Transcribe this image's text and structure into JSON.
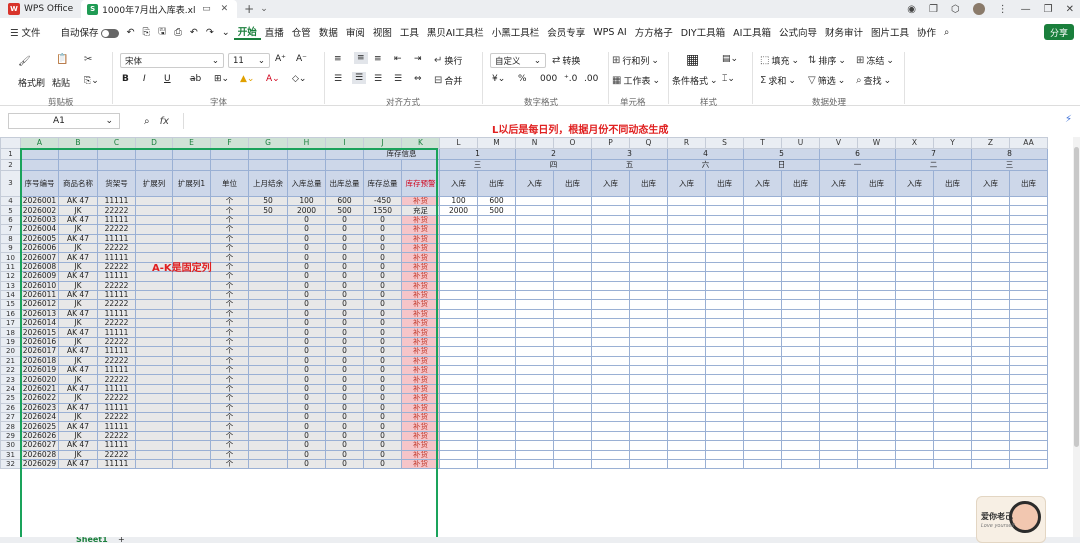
{
  "titlebar": {
    "app_name": "WPS Office",
    "file_tab": "1000年7月出入库表.xlsx",
    "new_tab": "+"
  },
  "menubar": {
    "file_menu": "☰ 文件",
    "autosave": "自动保存",
    "tabs": [
      "开始",
      "直播",
      "仓管",
      "数据",
      "审阅",
      "视图",
      "工具",
      "黑贝AI工具栏",
      "小黑工具栏",
      "会员专享",
      "WPS AI",
      "方方格子",
      "DIY工具箱",
      "AI工具箱",
      "公式向导",
      "财务审计",
      "图片工具",
      "协作"
    ],
    "active_tab": "开始",
    "share": "分享"
  },
  "ribbon": {
    "format_painter": "格式刷",
    "paste": "粘贴",
    "clipboard_label": "剪贴板",
    "font_name": "宋体",
    "font_size": "11",
    "font_label": "字体",
    "bold": "B",
    "italic": "I",
    "underline": "U",
    "wrap": "换行",
    "merge": "合并",
    "align_label": "对齐方式",
    "number_format": "自定义",
    "convert": "转换",
    "number_label": "数字格式",
    "row_col": "行和列",
    "worksheet": "工作表",
    "cell_label": "单元格",
    "cond_format": "条件格式",
    "style_label": "样式",
    "fill": "填充",
    "sort": "排序",
    "freeze": "冻结",
    "sum": "求和",
    "filter": "筛选",
    "find": "查找",
    "data_label": "数据处理"
  },
  "formula_bar": {
    "cell_ref": "A1",
    "fx": "fx",
    "value": ""
  },
  "sheet": {
    "columns": [
      "A",
      "B",
      "C",
      "D",
      "E",
      "F",
      "G",
      "H",
      "I",
      "J",
      "K",
      "L",
      "M",
      "N",
      "O",
      "P",
      "Q",
      "R",
      "S",
      "T",
      "U",
      "V",
      "W",
      "X",
      "Y",
      "Z",
      "AA"
    ],
    "header_row3": [
      "序号编号",
      "商品名称",
      "货架号",
      "扩展列",
      "扩展列1",
      "单位",
      "上月结余",
      "入库总量",
      "出库总量",
      "库存总量",
      "库存预警"
    ],
    "stock_info_label": "库存信息",
    "days": [
      "1",
      "2",
      "3",
      "4",
      "5",
      "6",
      "7",
      "8"
    ],
    "weekdays": [
      "三",
      "四",
      "五",
      "六",
      "日",
      "一",
      "二",
      "三"
    ],
    "in_label": "入库",
    "out_label": "出库",
    "row_numbers": [
      "1",
      "2",
      "3",
      "4",
      "5",
      "6",
      "7",
      "8",
      "9",
      "10",
      "11",
      "12",
      "13",
      "14",
      "15",
      "16",
      "17",
      "18",
      "19",
      "20",
      "21",
      "22",
      "23",
      "24",
      "25",
      "26",
      "27",
      "28",
      "29",
      "30",
      "31",
      "32"
    ],
    "data_rows": [
      {
        "id": "2026001",
        "name": "AK 47",
        "shelf": "11111",
        "unit": "个",
        "prev": "50",
        "in": "100",
        "out": "600",
        "stock": "-450",
        "warn": "补货",
        "d_in": "100",
        "d_out": "600"
      },
      {
        "id": "2026002",
        "name": "JK",
        "shelf": "22222",
        "unit": "个",
        "prev": "50",
        "in": "2000",
        "out": "500",
        "stock": "1550",
        "warn": "充足",
        "d_in": "2000",
        "d_out": "500"
      },
      {
        "id": "2026003",
        "name": "AK 47",
        "shelf": "11111",
        "unit": "个",
        "prev": "",
        "in": "0",
        "out": "0",
        "stock": "0",
        "warn": "补货"
      },
      {
        "id": "2026004",
        "name": "JK",
        "shelf": "22222",
        "unit": "个",
        "prev": "",
        "in": "0",
        "out": "0",
        "stock": "0",
        "warn": "补货"
      },
      {
        "id": "2026005",
        "name": "AK 47",
        "shelf": "11111",
        "unit": "个",
        "prev": "",
        "in": "0",
        "out": "0",
        "stock": "0",
        "warn": "补货"
      },
      {
        "id": "2026006",
        "name": "JK",
        "shelf": "22222",
        "unit": "个",
        "prev": "",
        "in": "0",
        "out": "0",
        "stock": "0",
        "warn": "补货"
      },
      {
        "id": "2026007",
        "name": "AK 47",
        "shelf": "11111",
        "unit": "个",
        "prev": "",
        "in": "0",
        "out": "0",
        "stock": "0",
        "warn": "补货"
      },
      {
        "id": "2026008",
        "name": "JK",
        "shelf": "22222",
        "unit": "个",
        "prev": "",
        "in": "0",
        "out": "0",
        "stock": "0",
        "warn": "补货"
      },
      {
        "id": "2026009",
        "name": "AK 47",
        "shelf": "11111",
        "unit": "个",
        "prev": "",
        "in": "0",
        "out": "0",
        "stock": "0",
        "warn": "补货"
      },
      {
        "id": "2026010",
        "name": "JK",
        "shelf": "22222",
        "unit": "个",
        "prev": "",
        "in": "0",
        "out": "0",
        "stock": "0",
        "warn": "补货"
      },
      {
        "id": "2026011",
        "name": "AK 47",
        "shelf": "11111",
        "unit": "个",
        "prev": "",
        "in": "0",
        "out": "0",
        "stock": "0",
        "warn": "补货"
      },
      {
        "id": "2026012",
        "name": "JK",
        "shelf": "22222",
        "unit": "个",
        "prev": "",
        "in": "0",
        "out": "0",
        "stock": "0",
        "warn": "补货"
      },
      {
        "id": "2026013",
        "name": "AK 47",
        "shelf": "11111",
        "unit": "个",
        "prev": "",
        "in": "0",
        "out": "0",
        "stock": "0",
        "warn": "补货"
      },
      {
        "id": "2026014",
        "name": "JK",
        "shelf": "22222",
        "unit": "个",
        "prev": "",
        "in": "0",
        "out": "0",
        "stock": "0",
        "warn": "补货"
      },
      {
        "id": "2026015",
        "name": "AK 47",
        "shelf": "11111",
        "unit": "个",
        "prev": "",
        "in": "0",
        "out": "0",
        "stock": "0",
        "warn": "补货"
      },
      {
        "id": "2026016",
        "name": "JK",
        "shelf": "22222",
        "unit": "个",
        "prev": "",
        "in": "0",
        "out": "0",
        "stock": "0",
        "warn": "补货"
      },
      {
        "id": "2026017",
        "name": "AK 47",
        "shelf": "11111",
        "unit": "个",
        "prev": "",
        "in": "0",
        "out": "0",
        "stock": "0",
        "warn": "补货"
      },
      {
        "id": "2026018",
        "name": "JK",
        "shelf": "22222",
        "unit": "个",
        "prev": "",
        "in": "0",
        "out": "0",
        "stock": "0",
        "warn": "补货"
      },
      {
        "id": "2026019",
        "name": "AK 47",
        "shelf": "11111",
        "unit": "个",
        "prev": "",
        "in": "0",
        "out": "0",
        "stock": "0",
        "warn": "补货"
      },
      {
        "id": "2026020",
        "name": "JK",
        "shelf": "22222",
        "unit": "个",
        "prev": "",
        "in": "0",
        "out": "0",
        "stock": "0",
        "warn": "补货"
      },
      {
        "id": "2026021",
        "name": "AK 47",
        "shelf": "11111",
        "unit": "个",
        "prev": "",
        "in": "0",
        "out": "0",
        "stock": "0",
        "warn": "补货"
      },
      {
        "id": "2026022",
        "name": "JK",
        "shelf": "22222",
        "unit": "个",
        "prev": "",
        "in": "0",
        "out": "0",
        "stock": "0",
        "warn": "补货"
      },
      {
        "id": "2026023",
        "name": "AK 47",
        "shelf": "11111",
        "unit": "个",
        "prev": "",
        "in": "0",
        "out": "0",
        "stock": "0",
        "warn": "补货"
      },
      {
        "id": "2026024",
        "name": "JK",
        "shelf": "22222",
        "unit": "个",
        "prev": "",
        "in": "0",
        "out": "0",
        "stock": "0",
        "warn": "补货"
      },
      {
        "id": "2026025",
        "name": "AK 47",
        "shelf": "11111",
        "unit": "个",
        "prev": "",
        "in": "0",
        "out": "0",
        "stock": "0",
        "warn": "补货"
      },
      {
        "id": "2026026",
        "name": "JK",
        "shelf": "22222",
        "unit": "个",
        "prev": "",
        "in": "0",
        "out": "0",
        "stock": "0",
        "warn": "补货"
      },
      {
        "id": "2026027",
        "name": "AK 47",
        "shelf": "11111",
        "unit": "个",
        "prev": "",
        "in": "0",
        "out": "0",
        "stock": "0",
        "warn": "补货"
      },
      {
        "id": "2026028",
        "name": "JK",
        "shelf": "22222",
        "unit": "个",
        "prev": "",
        "in": "0",
        "out": "0",
        "stock": "0",
        "warn": "补货"
      },
      {
        "id": "2026029",
        "name": "AK 47",
        "shelf": "11111",
        "unit": "个",
        "prev": "",
        "in": "0",
        "out": "0",
        "stock": "0",
        "warn": "补货"
      }
    ]
  },
  "annotations": {
    "dynamic_cols": "L以后是每日列，根据月份不同动态生成",
    "fixed_cols": "A-K是固定列"
  },
  "sheet_tabs": {
    "active": "Sheet1",
    "add": "+"
  },
  "sticker": {
    "text": "爱你老己",
    "sub": "Love yourself"
  },
  "colors": {
    "accent": "#1a7f3c",
    "header_fill": "#cdd7e9",
    "fixed_fill": "#e8e8e8",
    "warning_fill": "#f6c5c9",
    "annotation": "#e02020"
  }
}
